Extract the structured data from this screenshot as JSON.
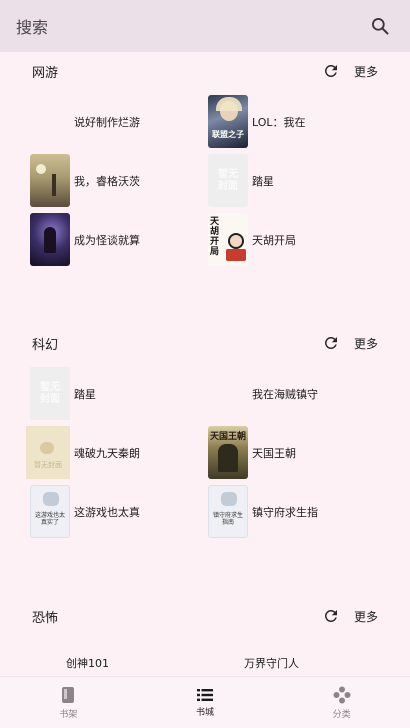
{
  "topbar": {
    "title": "搜索",
    "search_icon": "search-icon"
  },
  "sections": [
    {
      "title": "网游",
      "more": "更多",
      "books": [
        {
          "name": "说好制作烂游",
          "cover": "none"
        },
        {
          "name": "LOL：我在",
          "cover": "image"
        },
        {
          "name": "我，睿格沃茨",
          "cover": "image"
        },
        {
          "name": "踏星",
          "cover": "placeholder"
        },
        {
          "name": "成为怪谈就算",
          "cover": "image"
        },
        {
          "name": "天胡开局",
          "cover": "image"
        }
      ]
    },
    {
      "title": "科幻",
      "more": "更多",
      "books": [
        {
          "name": "踏星",
          "cover": "placeholder"
        },
        {
          "name": "我在海贼镇守",
          "cover": "none"
        },
        {
          "name": "魂破九天秦朗",
          "cover": "placeholder-beige"
        },
        {
          "name": "天国王朝",
          "cover": "image"
        },
        {
          "name": "这游戏也太真",
          "cover": "cat"
        },
        {
          "name": "镇守府求生指",
          "cover": "cat"
        }
      ]
    },
    {
      "title": "恐怖",
      "more": "更多",
      "books": [
        {
          "name": "创神101",
          "cover": "none"
        },
        {
          "name": "万界守门人",
          "cover": "none"
        }
      ]
    }
  ],
  "cover_texts": {
    "placeholder": "暂无封面",
    "lol": "联盟之子",
    "tianhu": "天胡开局",
    "tianguo": "天国王朝",
    "cat1": "这游戏也太真实了",
    "cat2": "镇守府求生指南"
  },
  "nav": [
    {
      "label": "书架",
      "icon": "bookshelf-icon"
    },
    {
      "label": "书城",
      "icon": "list-icon",
      "active": true
    },
    {
      "label": "分类",
      "icon": "category-icon"
    }
  ],
  "colors": {
    "background": "#fdf1f5",
    "topbar": "#ebe0e8",
    "text": "#1e1b1e"
  }
}
